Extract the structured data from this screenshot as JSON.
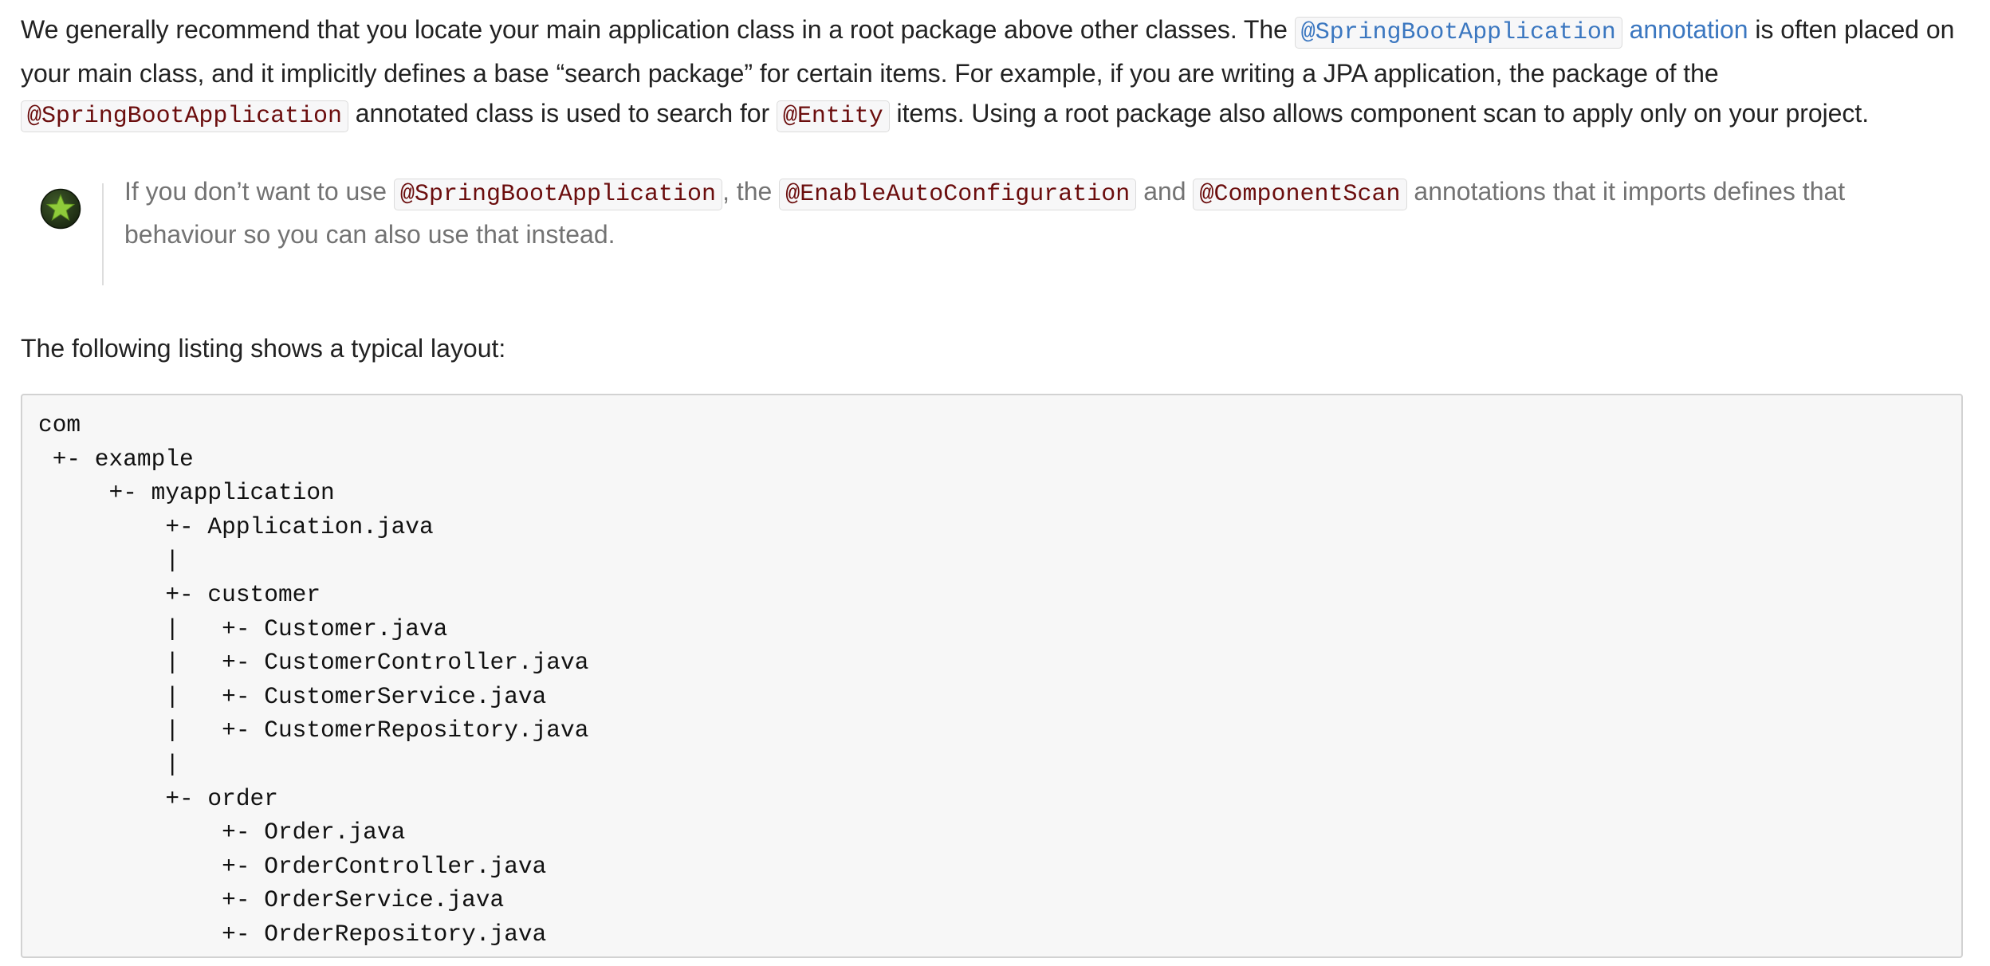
{
  "para1": {
    "text_a": "We generally recommend that you locate your main application class in a root package above other classes. The ",
    "link_code": "@SpringBootApplication",
    "link_text": "annotation",
    "text_b": " is often placed on your main class, and it implicitly defines a base “search package” for certain items. For example, if you are writing a JPA application, the package of the ",
    "code_1": "@SpringBootApplication",
    "text_c": " annotated class is used to search for ",
    "code_2": "@Entity",
    "text_d": " items. Using a root package also allows component scan to apply only on your project."
  },
  "note": {
    "icon": "tip-star-icon",
    "text_a": "If you don’t want to use ",
    "code_1": "@SpringBootApplication",
    "text_b": ", the ",
    "code_2": "@EnableAutoConfiguration",
    "text_c": " and ",
    "code_3": "@ComponentScan",
    "text_d": " annotations that it imports defines that behaviour so you can also use that instead."
  },
  "lead": "The following listing shows a typical layout:",
  "listing": {
    "lines": [
      "com",
      " +- example",
      "     +- myapplication",
      "         +- Application.java",
      "         |",
      "         +- customer",
      "         |   +- Customer.java",
      "         |   +- CustomerController.java",
      "         |   +- CustomerService.java",
      "         |   +- CustomerRepository.java",
      "         |",
      "         +- order",
      "             +- Order.java",
      "             +- OrderController.java",
      "             +- OrderService.java",
      "             +- OrderRepository.java"
    ]
  },
  "colors": {
    "text": "#222222",
    "note_text": "#737373",
    "link": "#3b77c0",
    "code": "#6b0d0d",
    "code_bg": "#f7f7f8",
    "listing_bg": "#f7f7f7"
  }
}
